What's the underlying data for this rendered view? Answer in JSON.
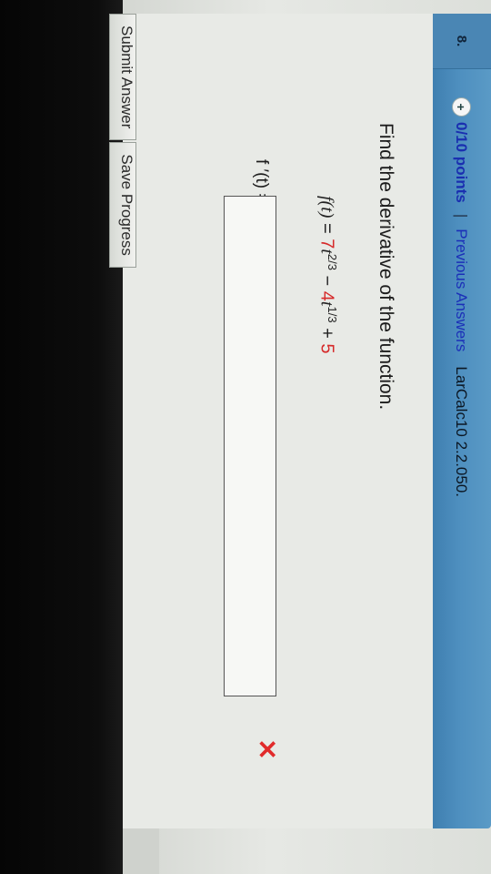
{
  "question": {
    "number": "8.",
    "points": "0/10 points",
    "separator": "|",
    "previous_answers": "Previous Answers",
    "reference": "LarCalc10 2.2.050."
  },
  "problem": {
    "prompt": "Find the derivative of the function.",
    "function": {
      "lhs": "f(t)",
      "equals": " = ",
      "term1_coef": "7",
      "term1_var": "t",
      "term1_exp": "2/3",
      "minus": " − ",
      "term2_coef": "4",
      "term2_var": "t",
      "term2_exp": "1/3",
      "plus": " + ",
      "constant": "5"
    },
    "answer_label": "f ′(t) =",
    "answer_value": "",
    "status_icon": "x-wrong-icon"
  },
  "buttons": {
    "submit": "Submit Answer",
    "save": "Save Progress"
  },
  "colors": {
    "header": "#4e8fbf",
    "red_value": "#d62a2a",
    "link": "#1b2fb8"
  }
}
